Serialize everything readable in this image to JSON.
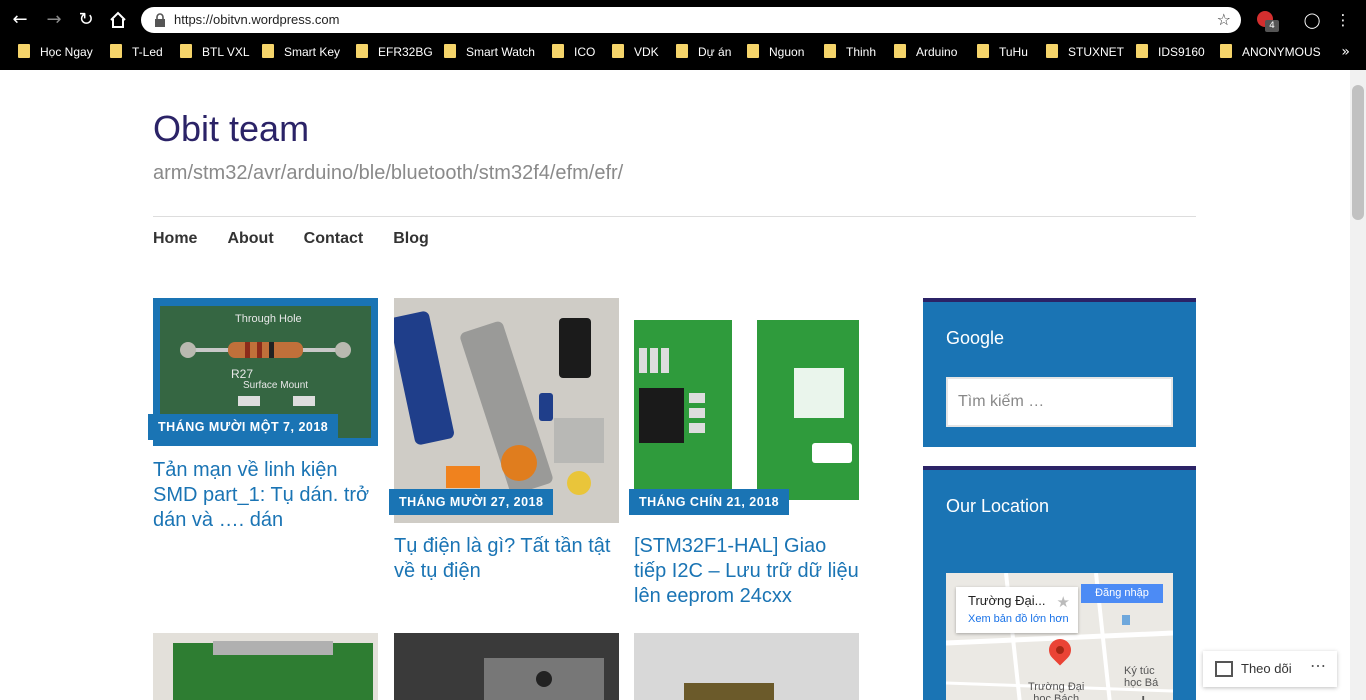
{
  "browser": {
    "url": "https://obitvn.wordpress.com",
    "extension_badge": "4"
  },
  "bookmarks": [
    "Học Ngay",
    "T-Led",
    "BTL VXL",
    "Smart Key",
    "EFR32BG",
    "Smart Watch",
    "ICO",
    "VDK",
    "Dự án",
    "Nguon",
    "Thinh",
    "Arduino",
    "TuHu",
    "STUXNET",
    "IDS9160",
    "ANONYMOUS"
  ],
  "site": {
    "title": "Obit team",
    "tagline": "arm/stm32/avr/arduino/ble/bluetooth/stm32f4/efm/efr/"
  },
  "menu": [
    "Home",
    "About",
    "Contact",
    "Blog"
  ],
  "posts": [
    {
      "date": "THÁNG MƯỜI MỘT 7, 2018",
      "title": "Tản mạn về linh kiện SMD part_1: Tụ dán. trở dán và …. dán"
    },
    {
      "date": "THÁNG MƯỜI 27, 2018",
      "title": "Tụ điện là gì? Tất tần tật về tụ điện"
    },
    {
      "date": "THÁNG CHÍN 21, 2018",
      "title": "[STM32F1-HAL] Giao tiếp I2C – Lưu trữ dữ liệu lên eeprom 24cxx"
    }
  ],
  "thumb_text": {
    "through_hole": "Through Hole",
    "r27": "R27",
    "surface_mount": "Surface Mount"
  },
  "sidebar": {
    "google_title": "Google",
    "search_placeholder": "Tìm kiếm …",
    "location_title": "Our Location",
    "map": {
      "place_name": "Trường Đại...",
      "view_larger": "Xem bản đồ lớn hơn",
      "login": "Đăng nhập",
      "label": "Trường Đại\nhọc Bách",
      "poi": "Ký túc\nhọc Bá"
    }
  },
  "follow": {
    "label": "Theo dõi"
  },
  "colors": {
    "accent": "#1a74b4",
    "title": "#2b2367"
  }
}
